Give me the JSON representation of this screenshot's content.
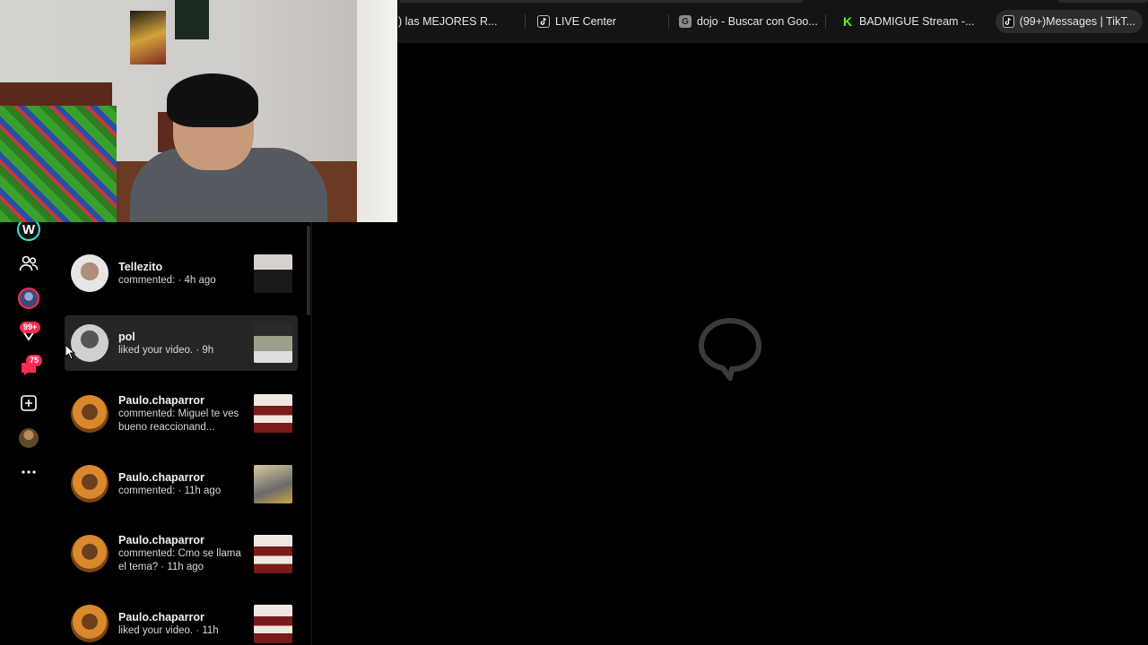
{
  "tabs": [
    {
      "label": ") las MEJORES R...",
      "icon": "none"
    },
    {
      "label": "LIVE Center",
      "icon": "tiktok-icon"
    },
    {
      "label": "dojo - Buscar con Goo...",
      "icon": "google-icon",
      "icon_glyph": "G"
    },
    {
      "label": "BADMIGUE Stream -...",
      "icon": "kick-icon",
      "icon_glyph": "K"
    },
    {
      "label": "(99+)Messages | TikT...",
      "icon": "tiktok-icon",
      "active": true
    }
  ],
  "rail": {
    "logo": "W",
    "inbox_badge": "99+",
    "messages_badge": "75"
  },
  "notifications": [
    {
      "name": "Tellezito",
      "msg": "commented: · 4h ago",
      "avatar": "tellez",
      "thumb": "a"
    },
    {
      "name": "pol",
      "msg": "liked your video. · 9h",
      "avatar": "pol",
      "thumb": "b",
      "hover": true
    },
    {
      "name": "Paulo.chaparror",
      "msg": "commented: Miguel te ves bueno reaccionand...",
      "avatar": "paulo",
      "thumb": "red"
    },
    {
      "name": "Paulo.chaparror",
      "msg": "commented: · 11h ago",
      "avatar": "paulo",
      "thumb": "c"
    },
    {
      "name": "Paulo.chaparror",
      "msg": "commented: Cmo se llama el tema? · 11h ago",
      "avatar": "paulo",
      "thumb": "red"
    },
    {
      "name": "Paulo.chaparror",
      "msg": "liked your video. · 11h",
      "avatar": "paulo",
      "thumb": "red"
    }
  ],
  "colors": {
    "accent": "#fe2c55",
    "logo_ring": "#3fe0d0",
    "background": "#000000"
  }
}
